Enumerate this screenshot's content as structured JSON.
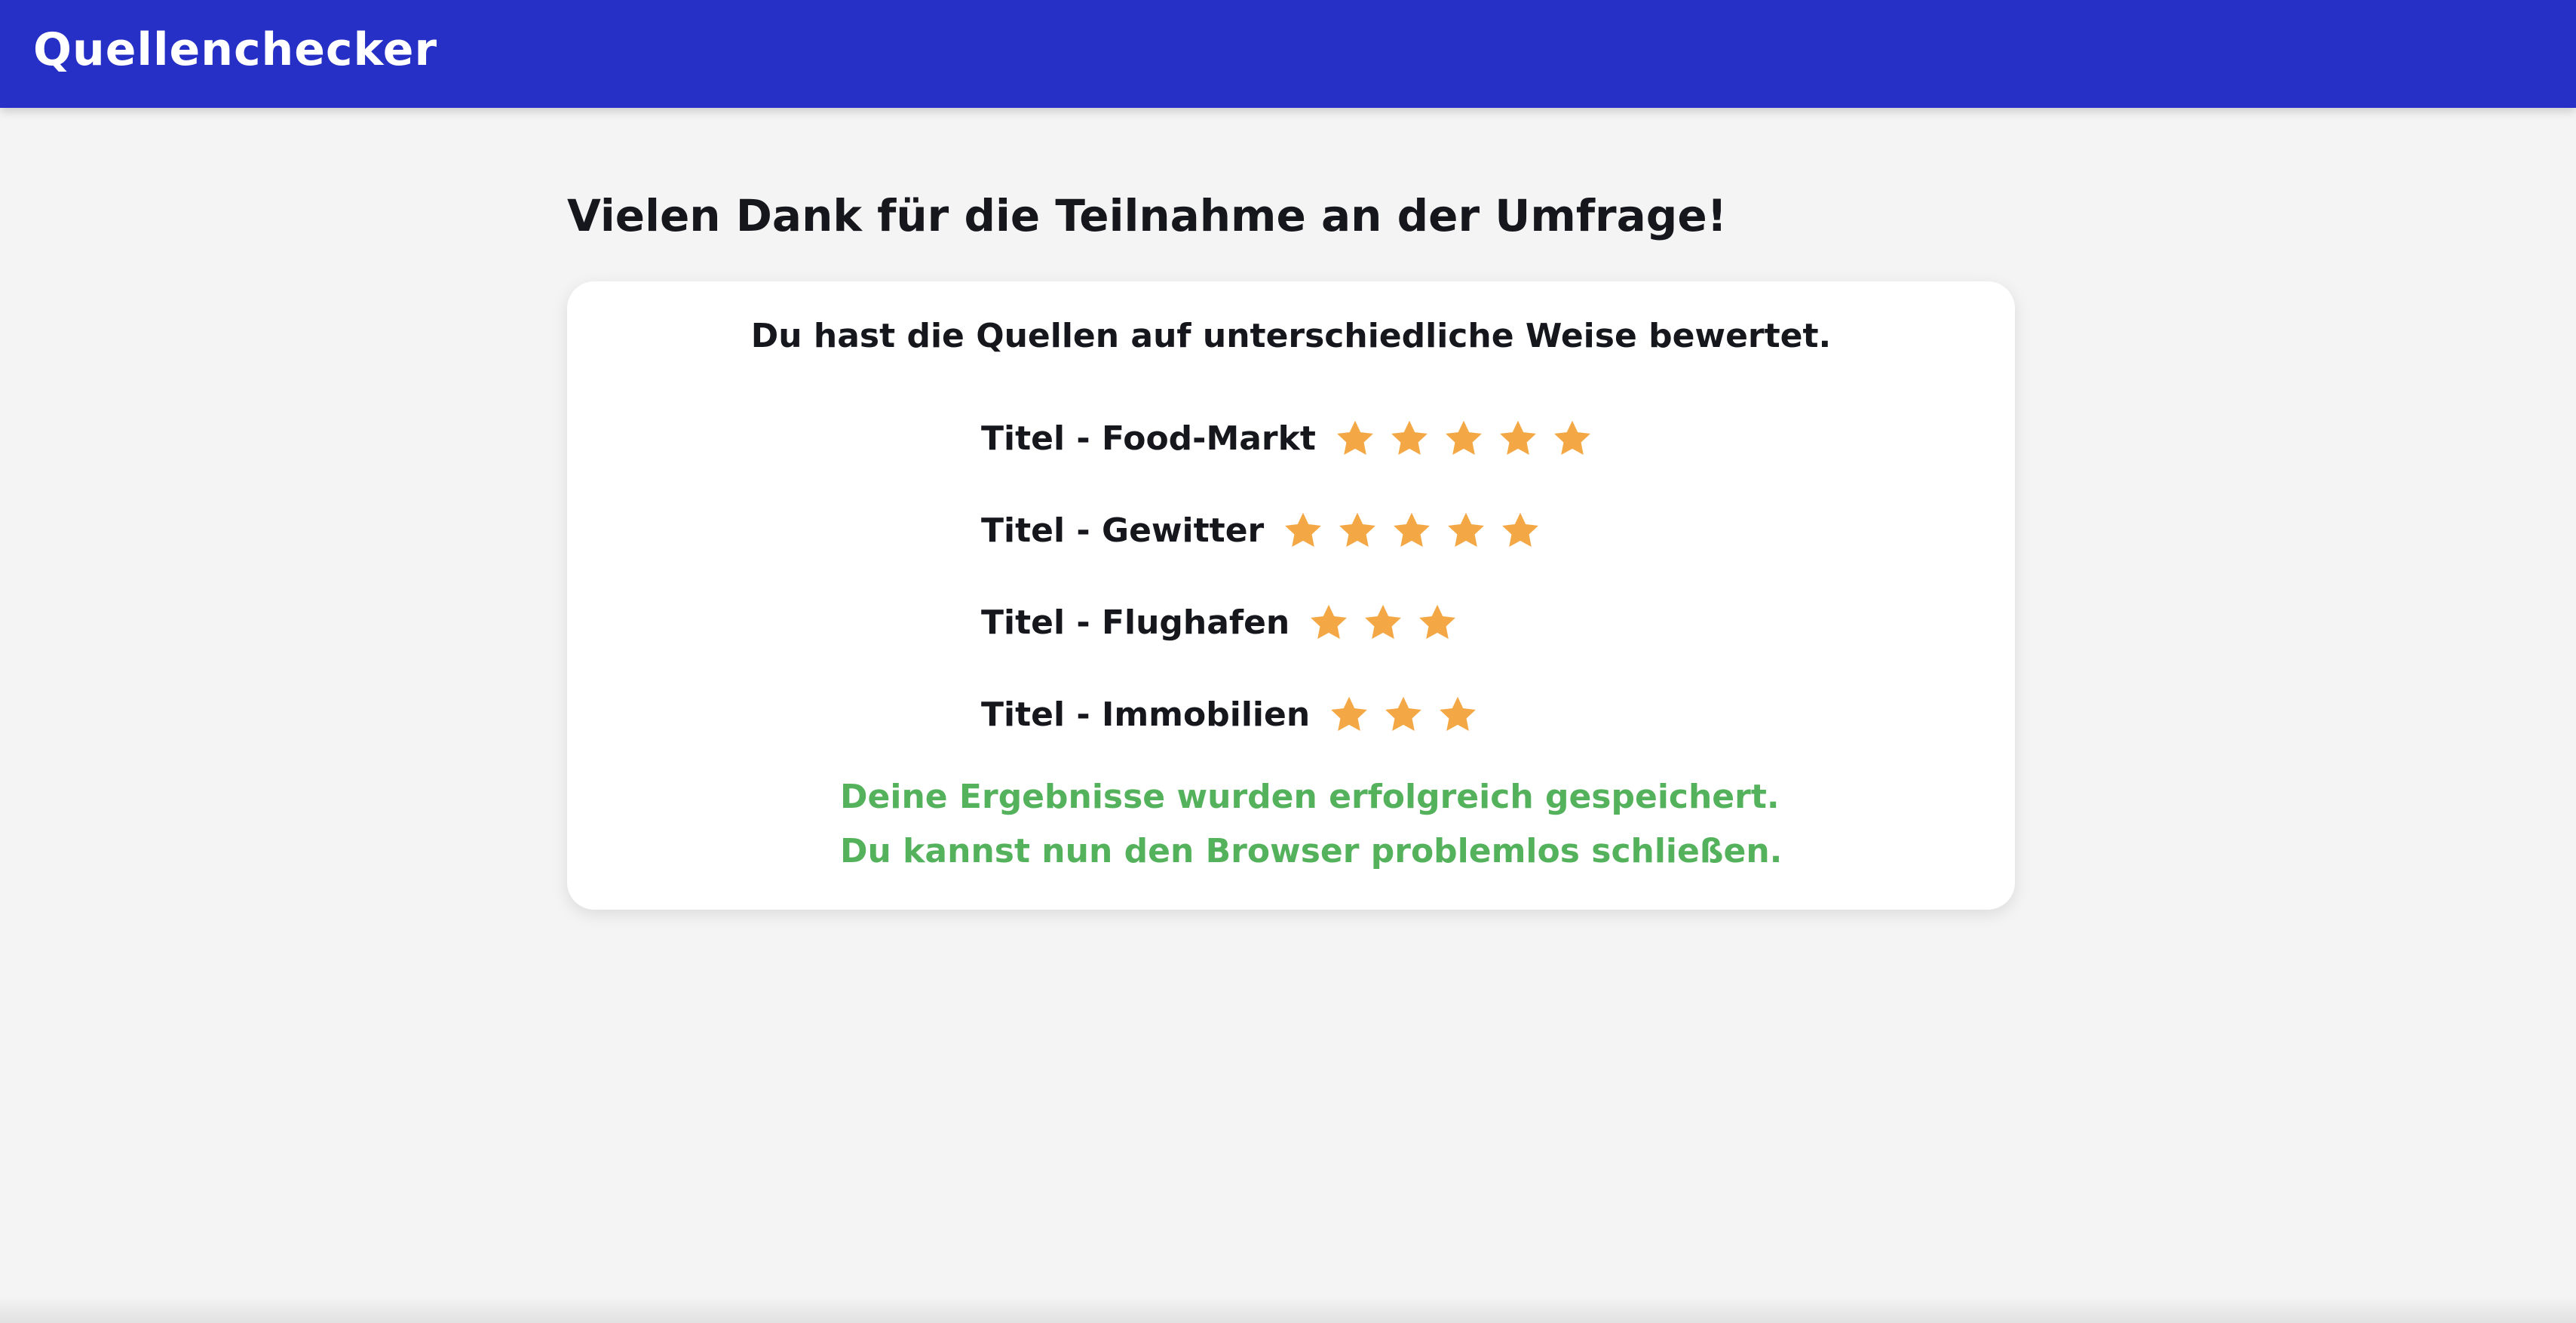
{
  "header": {
    "brand": "Quellenchecker",
    "color": "#2730c6"
  },
  "main": {
    "title": "Vielen Dank für die Teilnahme an der Umfrage!",
    "card": {
      "summary": "Du hast die Quellen auf unterschiedliche Weise bewertet.",
      "ratings": [
        {
          "label": "Titel - Food-Markt",
          "stars": 5
        },
        {
          "label": "Titel - Gewitter",
          "stars": 5
        },
        {
          "label": "Titel - Flughafen",
          "stars": 3
        },
        {
          "label": "Titel - Immobilien",
          "stars": 3
        }
      ],
      "success_line_1": "Deine Ergebnisse wurden erfolgreich gespeichert.",
      "success_line_2": "Du kannst nun den Browser problemlos schließen."
    }
  },
  "icons": {
    "star": "star-icon"
  },
  "colors": {
    "star": "#f4a845",
    "success": "#55b25c",
    "background": "#f4f4f4"
  }
}
